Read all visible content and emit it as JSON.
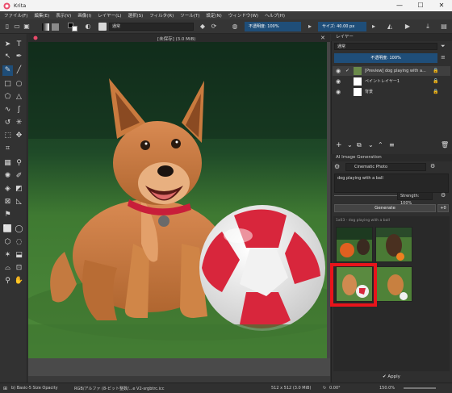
{
  "window": {
    "app_title": "Krita",
    "minimize": "—",
    "maximize": "☐",
    "close": "✕"
  },
  "menu": [
    "ファイル(F)",
    "編集(E)",
    "表示(V)",
    "画像(I)",
    "レイヤー(L)",
    "選択(S)",
    "フィルタ(R)",
    "ツール(T)",
    "設定(N)",
    "ウィンドウ(W)",
    "ヘルプ(H)"
  ],
  "toolbar": {
    "blend_mode": "通常",
    "opacity": "不透明度: 100%",
    "size": "サイズ: 40.00 px"
  },
  "document": {
    "tab_title": "[未保存]  (3.0 MiB)"
  },
  "layers": {
    "title": "レイヤー",
    "blend_mode": "通常",
    "opacity": "不透明度: 100%",
    "items": [
      {
        "name": "[Preview] dog playing with a..."
      },
      {
        "name": "ペイントレイヤー1"
      },
      {
        "name": "背景"
      }
    ]
  },
  "ai": {
    "title": "AI Image Generation",
    "style": "Cinematic Photo",
    "prompt": "dog playing with a ball",
    "strength": "Strength: 100%",
    "generate": "Generate",
    "count": "+0",
    "history_label": "1x03 - dog playing with a ball",
    "apply": "Apply"
  },
  "status": {
    "brush": "b) Basic-5 Size Opacity",
    "color": "RGB/アルファ (8-ビット整数/...e V2-srgbtrc.icc",
    "dimensions": "512 x 512 (3.0 MiB)",
    "rotation": "0.00°",
    "zoom": "150.0%"
  },
  "colors": {
    "accent": "#1f4e79",
    "highlight_box": "#e8141b"
  }
}
